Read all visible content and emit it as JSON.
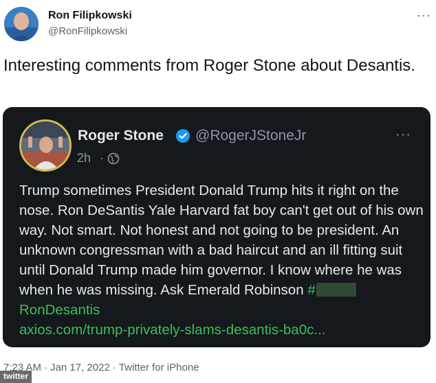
{
  "author": {
    "name": "Ron Filipkowski",
    "handle": "@RonFilipkowski"
  },
  "tweet": {
    "text": "Interesting comments from Roger Stone about Desantis."
  },
  "quoted": {
    "name": "Roger Stone",
    "handle": "@RogerJStoneJr",
    "time": "2h",
    "dot": "·",
    "body_main": "Trump sometimes President Donald Trump hits it right on the nose. Ron DeSantis Yale Harvard fat boy can't get out of his own way. Not smart. Not honest and not going to be president. An unknown congressman with a bad haircut and an ill fitting suit until Donald Trump made him governor. I know where he was when he was missing. Ask Emerald Robinson ",
    "hashtag_prefix": "#",
    "hashtag_suffix": "RonDesantis",
    "link": "axios.com/trump-privately-slams-desantis-ba0c..."
  },
  "meta": {
    "time": "7:23 AM",
    "sep": "·",
    "date": "Jan 17, 2022",
    "sep2": "·",
    "source": "Twitter for iPhone"
  },
  "watermark": "twitter",
  "colors": {
    "quote_bg": "#15181c",
    "verified": "#1d9bf0",
    "link": "#3bbf5c",
    "avatar_ring": "#d4b84a"
  },
  "icons": {
    "more": "more-horizontal-icon",
    "verified": "verified-badge-icon",
    "globe": "globe-icon"
  }
}
